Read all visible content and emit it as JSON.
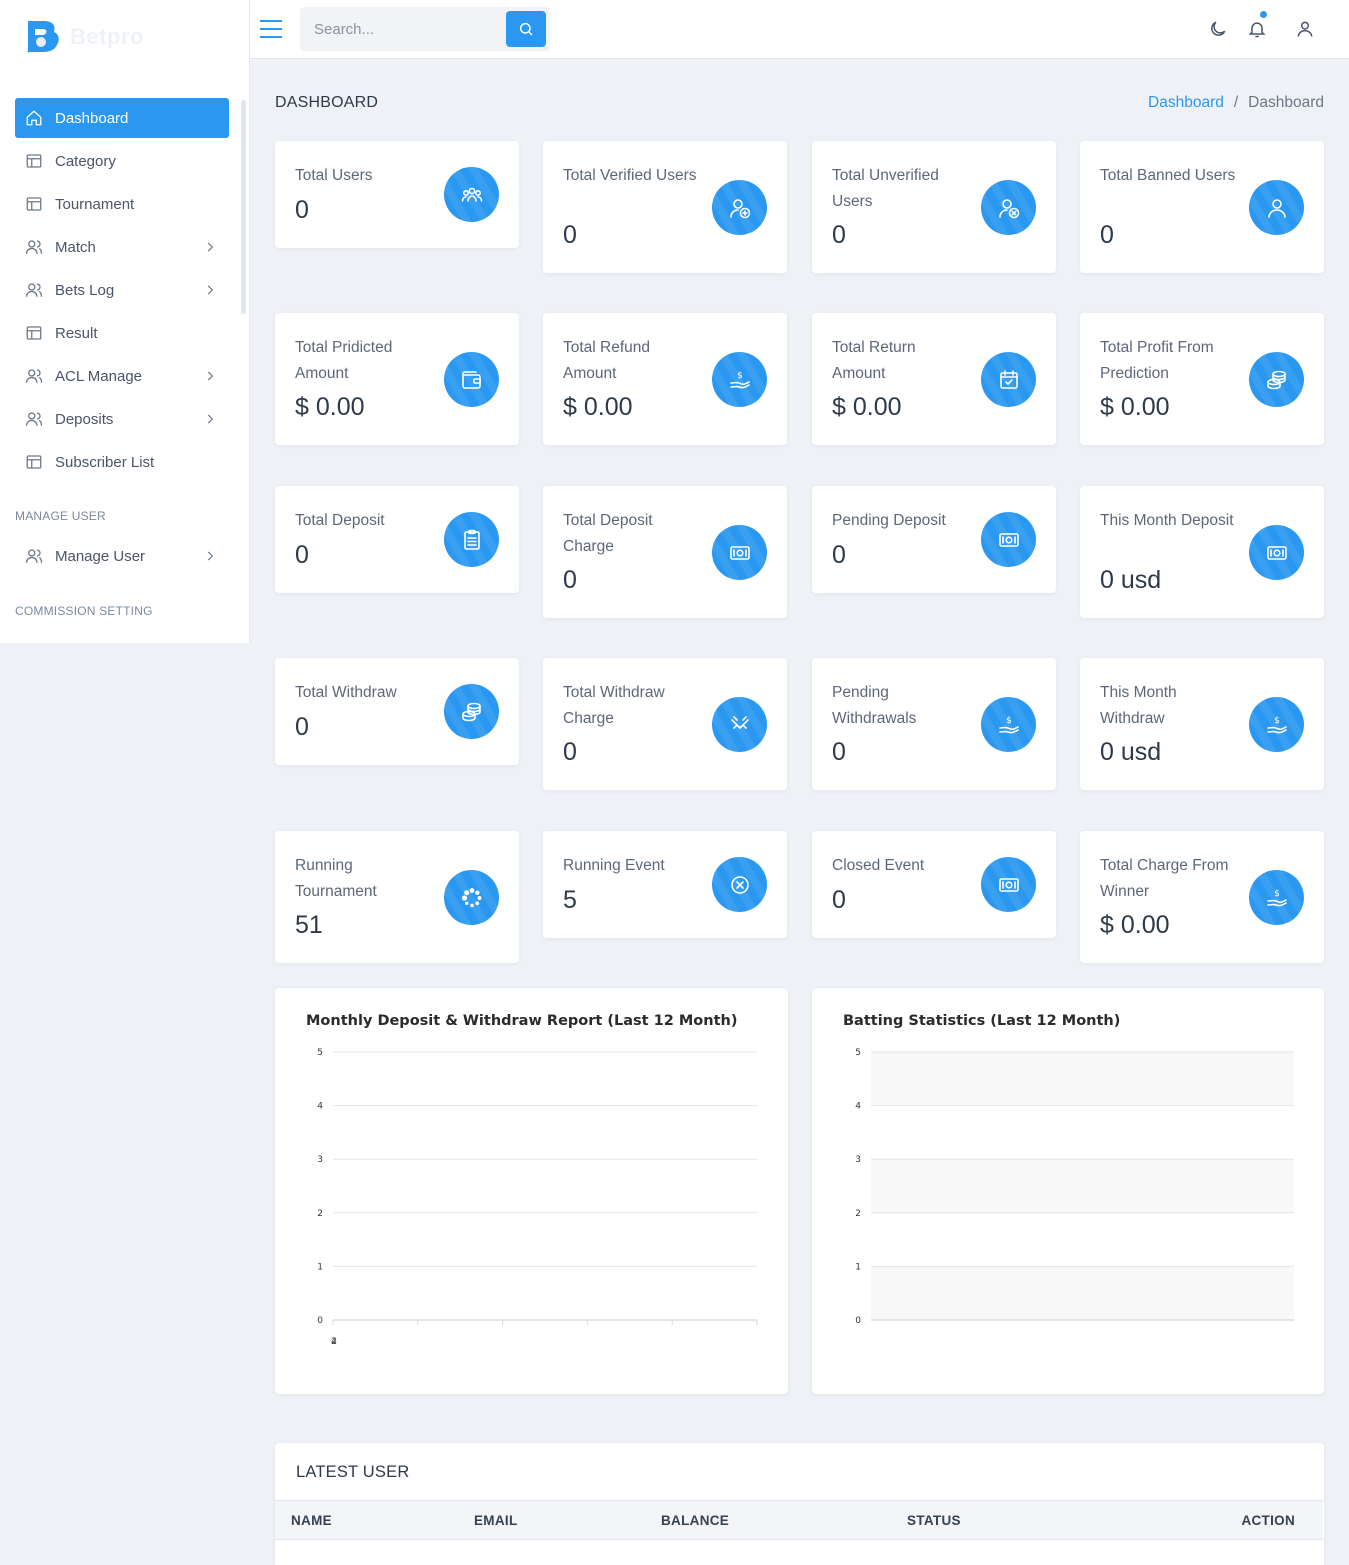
{
  "brand": {
    "name": "Betpro"
  },
  "sidebar": {
    "items": [
      {
        "label": "Dashboard",
        "icon": "home-icon",
        "active": true,
        "chevron": false
      },
      {
        "label": "Category",
        "icon": "table-icon",
        "chevron": false
      },
      {
        "label": "Tournament",
        "icon": "table-icon",
        "chevron": false
      },
      {
        "label": "Match",
        "icon": "users-icon",
        "chevron": true
      },
      {
        "label": "Bets Log",
        "icon": "users-icon",
        "chevron": true
      },
      {
        "label": "Result",
        "icon": "table-icon",
        "chevron": false
      },
      {
        "label": "ACL Manage",
        "icon": "users-icon",
        "chevron": true
      },
      {
        "label": "Deposits",
        "icon": "users-icon",
        "chevron": true
      },
      {
        "label": "Subscriber List",
        "icon": "table-icon",
        "chevron": false
      }
    ],
    "section_manage_user": "MANAGE USER",
    "manage_user_item": {
      "label": "Manage User",
      "icon": "users-icon",
      "chevron": true
    },
    "section_commission": "COMMISSION SETTING"
  },
  "topbar": {
    "search_placeholder": "Search...",
    "icons": [
      "menu-icon",
      "search-icon",
      "moon-icon",
      "bell-icon",
      "user-icon"
    ]
  },
  "page": {
    "title": "DASHBOARD",
    "breadcrumb": [
      "Dashboard",
      "Dashboard"
    ]
  },
  "stats": [
    {
      "label": "Total Users",
      "value": "0",
      "icon": "group-icon"
    },
    {
      "label": "Total Verified Users",
      "value": "0",
      "icon": "user-add-icon"
    },
    {
      "label": "Total Unverified Users",
      "value": "0",
      "icon": "user-remove-icon"
    },
    {
      "label": "Total Banned Users",
      "value": "0",
      "icon": "user-icon"
    },
    {
      "label": "Total Pridicted Amount",
      "value": "$ 0.00",
      "icon": "wallet-icon"
    },
    {
      "label": "Total Refund Amount",
      "value": "$ 0.00",
      "icon": "hand-money-icon"
    },
    {
      "label": "Total Return Amount",
      "value": "$ 0.00",
      "icon": "calendar-check-icon"
    },
    {
      "label": "Total Profit From Prediction",
      "value": "$ 0.00",
      "icon": "coins-icon"
    },
    {
      "label": "Total Deposit",
      "value": "0",
      "icon": "clipboard-icon"
    },
    {
      "label": "Total Deposit Charge",
      "value": "0",
      "icon": "cash-icon"
    },
    {
      "label": "Pending Deposit",
      "value": "0",
      "icon": "cash-icon"
    },
    {
      "label": "This Month Deposit",
      "value": "0 usd",
      "icon": "cash-icon"
    },
    {
      "label": "Total Withdraw",
      "value": "0",
      "icon": "coins-icon"
    },
    {
      "label": "Total Withdraw Charge",
      "value": "0",
      "icon": "handshake-icon"
    },
    {
      "label": "Pending Withdrawals",
      "value": "0",
      "icon": "hand-money-icon"
    },
    {
      "label": "This Month Withdraw",
      "value": "0 usd",
      "icon": "hand-money-icon"
    },
    {
      "label": "Running Tournament",
      "value": "51",
      "icon": "spinner-icon"
    },
    {
      "label": "Running Event",
      "value": "5",
      "icon": "close-circle-icon"
    },
    {
      "label": "Closed Event",
      "value": "0",
      "icon": "cash-icon"
    },
    {
      "label": "Total Charge From Winner",
      "value": "$ 0.00",
      "icon": "hand-money-icon"
    }
  ],
  "colors": {
    "accent": "#2a98f0",
    "background": "#eef1f5"
  },
  "chart_data": [
    {
      "type": "line",
      "title": "Monthly Deposit & Withdraw Report (Last 12 Month)",
      "ylim": [
        0,
        5
      ],
      "yticks": [
        "0",
        "1",
        "2",
        "3",
        "4",
        "5"
      ],
      "x_labels": [
        "2",
        "4"
      ],
      "series": [],
      "grid": true
    },
    {
      "type": "bar",
      "title": "Batting Statistics (Last 12 Month)",
      "ylim": [
        0,
        5
      ],
      "yticks": [
        "0",
        "1",
        "2",
        "3",
        "4",
        "5"
      ],
      "series": [],
      "grid": true
    }
  ],
  "latest_user": {
    "title": "LATEST USER",
    "columns": [
      "NAME",
      "EMAIL",
      "BALANCE",
      "STATUS",
      "ACTION"
    ]
  }
}
